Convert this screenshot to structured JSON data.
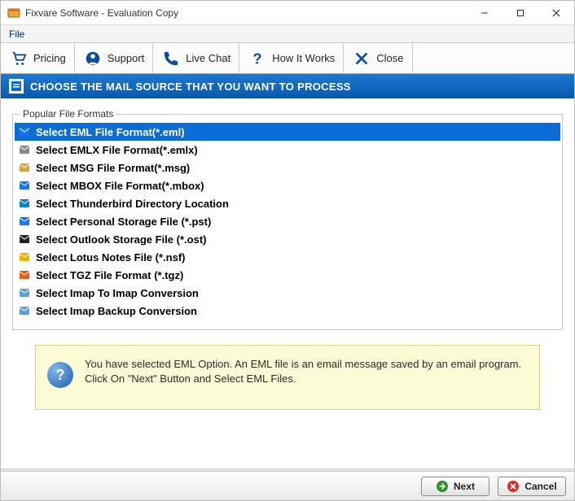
{
  "window": {
    "title": "Fixvare Software - Evaluation Copy"
  },
  "menubar": {
    "items": [
      "File"
    ]
  },
  "toolbar": {
    "pricing": "Pricing",
    "support": "Support",
    "live_chat": "Live Chat",
    "how_it_works": "How It Works",
    "close": "Close"
  },
  "section_header": "CHOOSE THE MAIL SOURCE THAT YOU WANT TO PROCESS",
  "popular_legend": "Popular File Formats",
  "formats": [
    {
      "label": "Select EML File Format(*.eml)",
      "icon": "eml",
      "selected": true
    },
    {
      "label": "Select EMLX File Format(*.emlx)",
      "icon": "emlx",
      "selected": false
    },
    {
      "label": "Select MSG File Format(*.msg)",
      "icon": "msg",
      "selected": false
    },
    {
      "label": "Select MBOX File Format(*.mbox)",
      "icon": "mbox",
      "selected": false
    },
    {
      "label": "Select Thunderbird Directory Location",
      "icon": "thunderbird",
      "selected": false
    },
    {
      "label": "Select Personal Storage File (*.pst)",
      "icon": "pst",
      "selected": false
    },
    {
      "label": "Select Outlook Storage File (*.ost)",
      "icon": "ost",
      "selected": false
    },
    {
      "label": "Select Lotus Notes File (*.nsf)",
      "icon": "nsf",
      "selected": false
    },
    {
      "label": "Select TGZ File Format (*.tgz)",
      "icon": "tgz",
      "selected": false
    },
    {
      "label": "Select Imap To Imap Conversion",
      "icon": "imap",
      "selected": false
    },
    {
      "label": "Select Imap Backup Conversion",
      "icon": "imap-backup",
      "selected": false
    }
  ],
  "info_text": "You have selected EML Option. An EML file is an email message saved by an email program. Click On \"Next\" Button and Select EML Files.",
  "footer": {
    "next": "Next",
    "cancel": "Cancel"
  },
  "colors": {
    "accent_blue": "#0a6cd6",
    "header_gradient_top": "#1b79d6",
    "header_gradient_bottom": "#0858ab",
    "info_bg": "#fbfbd6"
  }
}
